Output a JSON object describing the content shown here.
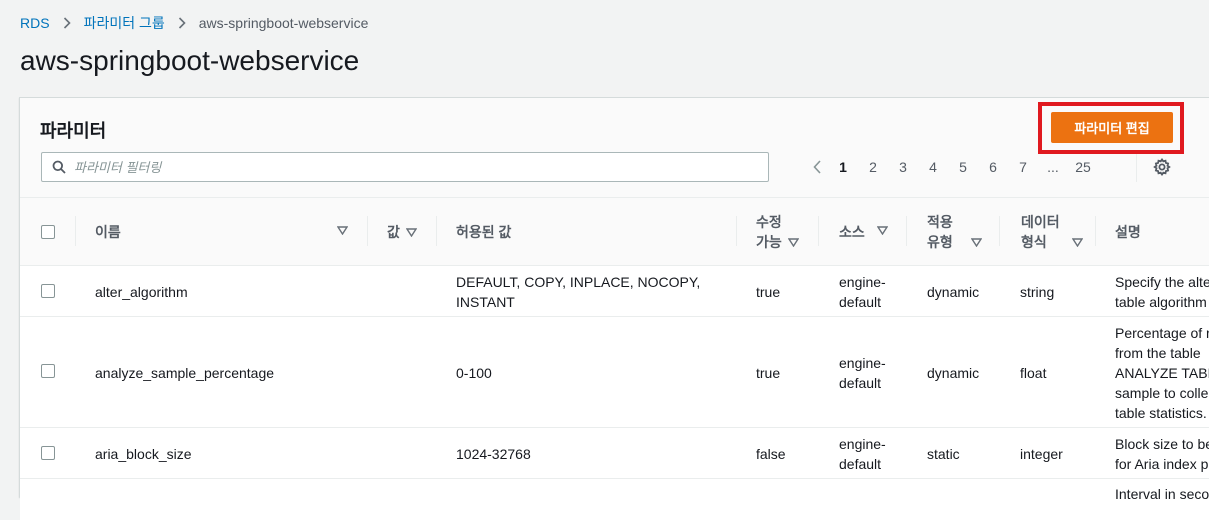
{
  "breadcrumb": {
    "root": "RDS",
    "group": "파라미터 그룹",
    "current": "aws-springboot-webservice"
  },
  "page": {
    "title": "aws-springboot-webservice"
  },
  "panel": {
    "title": "파라미터",
    "edit_button": "파라미터 편집",
    "search_placeholder": "파라미터 필터링"
  },
  "pagination": {
    "pages": [
      "1",
      "2",
      "3",
      "4",
      "5",
      "6",
      "7"
    ],
    "ellipsis": "...",
    "last": "25",
    "current": "1"
  },
  "table": {
    "headers": {
      "name": "이름",
      "value": "값",
      "allowed": "허용된 값",
      "modifiable_1": "수정",
      "modifiable_2": "가능",
      "source": "소스",
      "apply_1": "적용",
      "apply_2": "유형",
      "data_1": "데이터",
      "data_2": "형식",
      "desc": "설명"
    },
    "rows": [
      {
        "name": "alter_algorithm",
        "allowed_1": "DEFAULT, COPY, INPLACE, NOCOPY,",
        "allowed_2": "INSTANT",
        "modifiable": "true",
        "source_1": "engine-",
        "source_2": "default",
        "apply": "dynamic",
        "type": "string",
        "desc_1": "Specify the alte",
        "desc_2": "table algorithm"
      },
      {
        "name": "analyze_sample_percentage",
        "allowed_1": "0-100",
        "modifiable": "true",
        "source_1": "engine-",
        "source_2": "default",
        "apply": "dynamic",
        "type": "float",
        "desc_1": "Percentage of r",
        "desc_2": "from the table",
        "desc_3": "ANALYZE TABL",
        "desc_4": "sample to colle",
        "desc_5": "table statistics."
      },
      {
        "name": "aria_block_size",
        "allowed_1": "1024-32768",
        "modifiable": "false",
        "source_1": "engine-",
        "source_2": "default",
        "apply": "static",
        "type": "integer",
        "desc_1": "Block size to be",
        "desc_2": "for Aria index p"
      },
      {
        "desc_1": "Interval in seco"
      }
    ]
  },
  "colors": {
    "link": "#0073bb",
    "primary_button": "#ec7211",
    "highlight_box": "#e0191f"
  },
  "icons": [
    "chevron-right-icon",
    "search-icon",
    "chevron-left-icon",
    "settings-icon",
    "sort-triangle-icon"
  ]
}
